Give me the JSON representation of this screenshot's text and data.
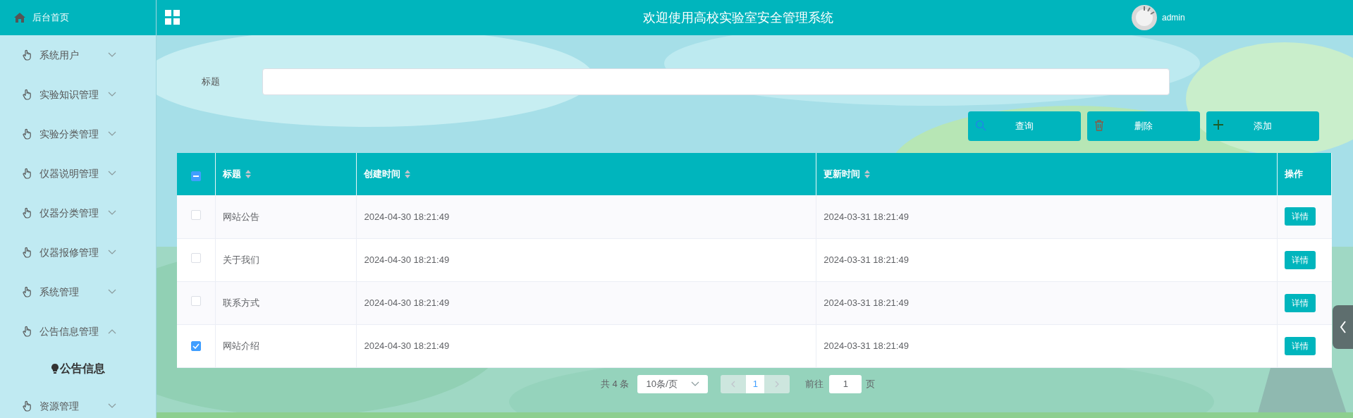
{
  "sidebar": {
    "home": "后台首页",
    "items": [
      {
        "label": "系统用户",
        "expanded": false
      },
      {
        "label": "实验知识管理",
        "expanded": false
      },
      {
        "label": "实验分类管理",
        "expanded": false
      },
      {
        "label": "仪器说明管理",
        "expanded": false
      },
      {
        "label": "仪器分类管理",
        "expanded": false
      },
      {
        "label": "仪器报修管理",
        "expanded": false
      },
      {
        "label": "系统管理",
        "expanded": false
      },
      {
        "label": "公告信息管理",
        "expanded": true,
        "children": [
          {
            "label": "公告信息"
          }
        ]
      },
      {
        "label": "资源管理",
        "expanded": false
      }
    ]
  },
  "header": {
    "title": "欢迎使用高校实验室安全管理系统",
    "user": "admin"
  },
  "search": {
    "label": "标题"
  },
  "buttons": [
    {
      "kind": "search",
      "label": "查询"
    },
    {
      "kind": "delete",
      "label": "删除"
    },
    {
      "kind": "add",
      "label": "添加"
    }
  ],
  "table": {
    "select_all": {
      "indeterminate": true
    },
    "columns": [
      {
        "label": "标题",
        "sortable": true
      },
      {
        "label": "创建时间",
        "sortable": true
      },
      {
        "label": "更新时间",
        "sortable": true
      },
      {
        "label": "操作",
        "sortable": false
      }
    ],
    "rows": [
      {
        "checked": false,
        "title": "网站公告",
        "created": "2024-04-30 18:21:49",
        "updated": "2024-03-31 18:21:49",
        "action": "详情"
      },
      {
        "checked": false,
        "title": "关于我们",
        "created": "2024-04-30 18:21:49",
        "updated": "2024-03-31 18:21:49",
        "action": "详情"
      },
      {
        "checked": false,
        "title": "联系方式",
        "created": "2024-04-30 18:21:49",
        "updated": "2024-03-31 18:21:49",
        "action": "详情"
      },
      {
        "checked": true,
        "title": "网站介绍",
        "created": "2024-04-30 18:21:49",
        "updated": "2024-03-31 18:21:49",
        "action": "详情"
      }
    ]
  },
  "pagination": {
    "total": "共 4 条",
    "page_size": "10条/页",
    "pages": [
      {
        "label": "1",
        "selected": true
      }
    ],
    "goto_label": "前往",
    "goto_value": "1",
    "goto_suffix": "页"
  }
}
